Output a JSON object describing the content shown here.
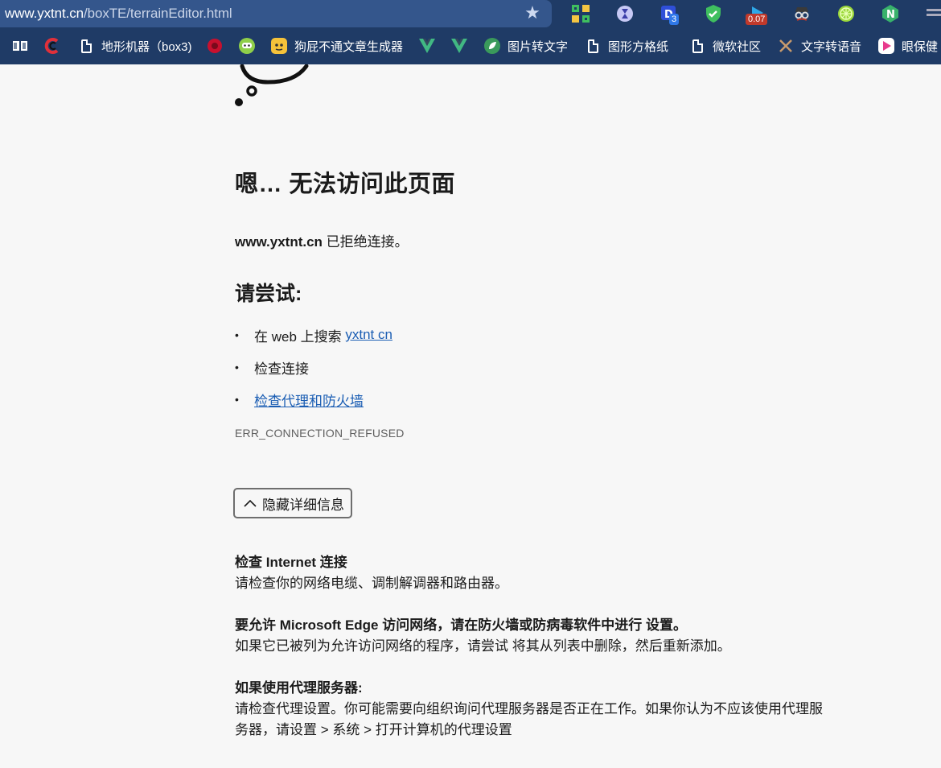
{
  "browser": {
    "url_host": "www.yxtnt.cn",
    "url_path": "/boxTE/terrainEditor.html",
    "extensions": [
      {
        "name": "qr-grid-icon",
        "badge": ""
      },
      {
        "name": "hourglass-icon",
        "badge": ""
      },
      {
        "name": "translate-icon",
        "badge": "3"
      },
      {
        "name": "shield-check-icon",
        "badge": ""
      },
      {
        "name": "play-icon",
        "badge": "0.07"
      },
      {
        "name": "spy-icon",
        "badge": ""
      },
      {
        "name": "lime-icon",
        "badge": ""
      },
      {
        "name": "n-icon",
        "badge": ""
      }
    ]
  },
  "bookmarks": [
    {
      "label": "",
      "icon": "book-icon"
    },
    {
      "label": "",
      "icon": "c-logo-icon"
    },
    {
      "label": "地形机器（box3)",
      "icon": "doc-icon"
    },
    {
      "label": "",
      "icon": "red-circle-icon"
    },
    {
      "label": "",
      "icon": "green-face-icon"
    },
    {
      "label": "狗屁不通文章生成器",
      "icon": "yellow-face-icon"
    },
    {
      "label": "",
      "icon": "vue-icon"
    },
    {
      "label": "",
      "icon": "vue-icon"
    },
    {
      "label": "图片转文字",
      "icon": "leaf-icon"
    },
    {
      "label": "图形方格纸",
      "icon": "doc-icon"
    },
    {
      "label": "微软社区",
      "icon": "doc-icon"
    },
    {
      "label": "文字转语音",
      "icon": "tools-icon"
    },
    {
      "label": "眼保健",
      "icon": "play-pink-icon"
    }
  ],
  "page": {
    "heading": "嗯… 无法访问此页面",
    "host": "www.yxtnt.cn",
    "refused_text": " 已拒绝连接。",
    "try_heading": "请尝试:",
    "try_items": {
      "search_prefix": "在 web 上搜索 ",
      "search_link": "yxtnt cn",
      "check_connection": "检查连接",
      "check_proxy_link": "检查代理和防火墙"
    },
    "error_code": "ERR_CONNECTION_REFUSED",
    "details_button": "隐藏详细信息",
    "sections": [
      {
        "title": "检查 Internet 连接",
        "body": "请检查你的网络电缆、调制解调器和路由器。"
      },
      {
        "title": "要允许 Microsoft Edge 访问网络，请在防火墙或防病毒软件中进行 设置。",
        "body": "如果它已被列为允许访问网络的程序，请尝试 将其从列表中删除，然后重新添加。"
      },
      {
        "title": "如果使用代理服务器:",
        "body": "请检查代理设置。你可能需要向组织询问代理服务器是否正在工作。如果你认为不应该使用代理服务器，请设置 > 系统 > 打开计算机的代理设置"
      }
    ]
  }
}
